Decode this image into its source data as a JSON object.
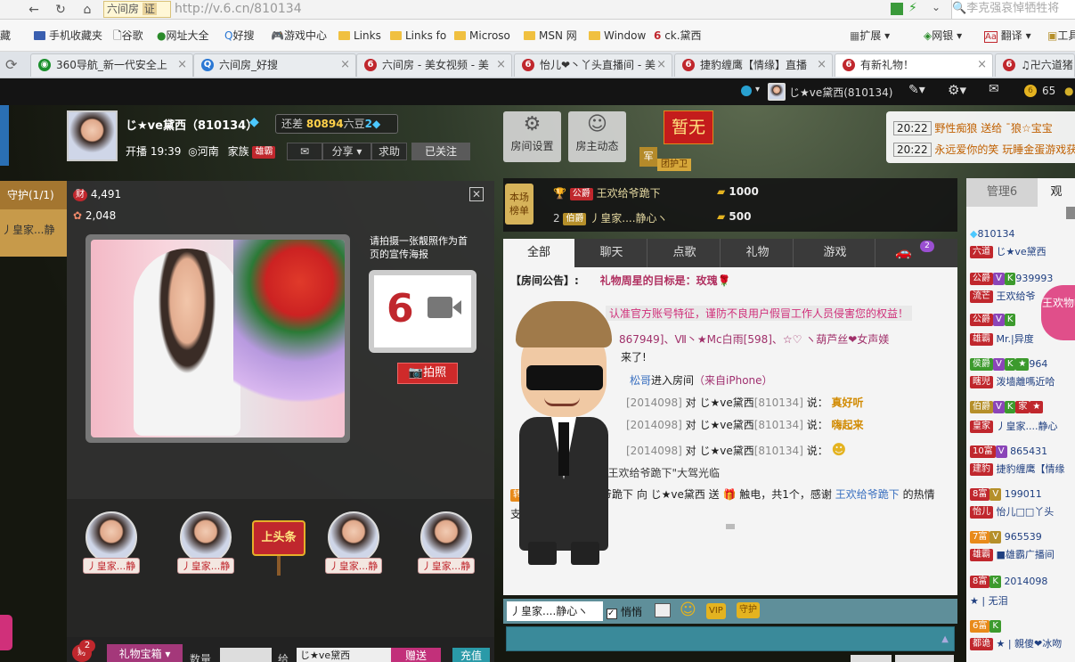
{
  "browser": {
    "url": "http://v.6.cn/810134",
    "site_label": "六间房",
    "cert_label": "证",
    "search_placeholder": "李克强哀悼牺牲将",
    "bookmarks": [
      "藏",
      "手机收藏夹",
      "谷歌",
      "网址大全",
      "好搜",
      "游戏中心",
      "Links",
      "Links fo",
      "Microso",
      "MSN 网",
      "Window",
      "ck.黛西"
    ],
    "bookmark_tools": [
      "扩展",
      "网银",
      "翻译",
      "工具"
    ],
    "tabs": [
      {
        "label": "360导航_新一代安全上",
        "color": "#1a8f2c"
      },
      {
        "label": "六间房_好搜",
        "color": "#2b78d4"
      },
      {
        "label": "六间房 - 美女视频 - 美",
        "color": "#c0272d"
      },
      {
        "label": "怡儿❤丶丫头直播间 - 美",
        "color": "#c0272d"
      },
      {
        "label": "捷豹缠鹰【情缘】直播",
        "color": "#c0272d"
      },
      {
        "label": "有新礼物！",
        "color": "#c0272d"
      },
      {
        "label": "♫卍六道猪",
        "color": "#c0272d"
      }
    ]
  },
  "sitebar": {
    "user": "じ★ve黛西(810134)",
    "coins": "65"
  },
  "host": {
    "name": "じ★ve黛西（810134）",
    "diff_label": "还差",
    "diff_value": "80894",
    "diff_unit": "六豆",
    "level": "2",
    "start_label": "开播",
    "start_time": "19:39",
    "location": "河南",
    "family_label": "家族",
    "family_tag": "雄霸",
    "share": "分享",
    "help": "求助",
    "follow": "已关注"
  },
  "room_btns": {
    "settings": "房间设置",
    "dynamics": "房主动态"
  },
  "guard": {
    "none": "暂无",
    "tag": "团护卫",
    "medal": "军"
  },
  "ticker": [
    {
      "time": "20:22",
      "text": "野性痴狼 送给 ¯狼☆宝宝"
    },
    {
      "time": "20:22",
      "text": "永远爱你的笑 玩睡金蛋游戏获"
    }
  ],
  "left": {
    "guard_tab": "守护(1/1)",
    "guard_member": "丿皇家...静",
    "wealth": "4,491",
    "flower": "2,048",
    "poster_text": "请拍摄一张靓照作为首页的宣传海报",
    "photo_btn": "拍照",
    "headline": "上头条",
    "fans": [
      "丿皇家...静",
      "丿皇家...静",
      "丿皇家...静",
      "丿皇家...静"
    ],
    "gift_btn": "礼物宝箱",
    "qty_label": "数量",
    "to_label": "给",
    "to_value": "じ★ve黛西",
    "send": "赠送",
    "recharge": "充值",
    "gift_badge": "2"
  },
  "rank": {
    "label": "本场榜单",
    "rows": [
      {
        "rank": "1",
        "tag": "公爵",
        "name": "王欢给爷跪下",
        "value": "1000"
      },
      {
        "rank": "2",
        "tag": "伯爵",
        "name": "丿皇家....静心ヽ",
        "value": "500"
      }
    ]
  },
  "chat_tabs": [
    "全部",
    "聊天",
    "点歌",
    "礼物",
    "游戏",
    "2"
  ],
  "chat": {
    "notice_label": "【房间公告】:",
    "notice_text": "礼物周星的目标是：玫瑰",
    "warn": "认准官方账号特征，谨防不良用户假冒工作人员侵害您的权益！",
    "line3": "867949]、Ⅶ丶★Mc白雨[598]、☆♡ ヽ葫芦丝❤女声媄",
    "line4": "来了!",
    "enter_name": "松哥",
    "enter_text": "进入房间",
    "enter_from": "（来自iPhone）",
    "says": [
      {
        "id": "[2014098]",
        "to": "じ★ve黛西",
        "toid": "[810134]",
        "verb": "说：",
        "msg": "真好听"
      },
      {
        "id": "[2014098]",
        "to": "じ★ve黛西",
        "toid": "[810134]",
        "verb": "说：",
        "msg": "嗨起来"
      },
      {
        "id": "[2014098]",
        "to": "じ★ve黛西",
        "toid": "[810134]",
        "verb": "说：",
        "msg": ""
      }
    ],
    "arrive": "\"王欢给爷跪下\"大驾光临",
    "gift_line": "给爷跪下 向 じ★ve黛西 送",
    "gift_item": "触电，共1个，感谢",
    "gift_thanks_name": "王欢给爷跪下",
    "gift_thanks_tail": "的热情",
    "support": "支持!",
    "input_target": "丿皇家....静心ヽ",
    "whisper": "悄悄",
    "vip": "VIP",
    "guard": "守护"
  },
  "right": {
    "tabs": [
      "管理6",
      "观"
    ],
    "float": "王欢物啦",
    "users": [
      {
        "id": "810134",
        "tag": "六道",
        "name": "じ★ve黛西"
      },
      {
        "id": "939993",
        "tag": "流芒",
        "name": "王欢给爷"
      },
      {
        "id": "",
        "tag": "雄霸",
        "name": "Mr.|异度"
      },
      {
        "id": "964",
        "tag": "瞎児",
        "name": "泼墙離嗎近哈"
      },
      {
        "id": "",
        "tag": "皇家",
        "name": "丿皇家....静心"
      },
      {
        "id": "865431",
        "tag": "建豹",
        "name": "捷豹缠鹰【情缘"
      },
      {
        "id": "199011",
        "tag": "怡儿",
        "name": "怡儿□□丫头"
      },
      {
        "id": "965539",
        "tag": "雄霸",
        "name": "■雄霸广播间"
      },
      {
        "id": "2014098",
        "tag": "★",
        "name": "| 无泪"
      },
      {
        "id": "",
        "tag": "都诡",
        "name": "★ | 親傻❤冰吻"
      }
    ]
  }
}
